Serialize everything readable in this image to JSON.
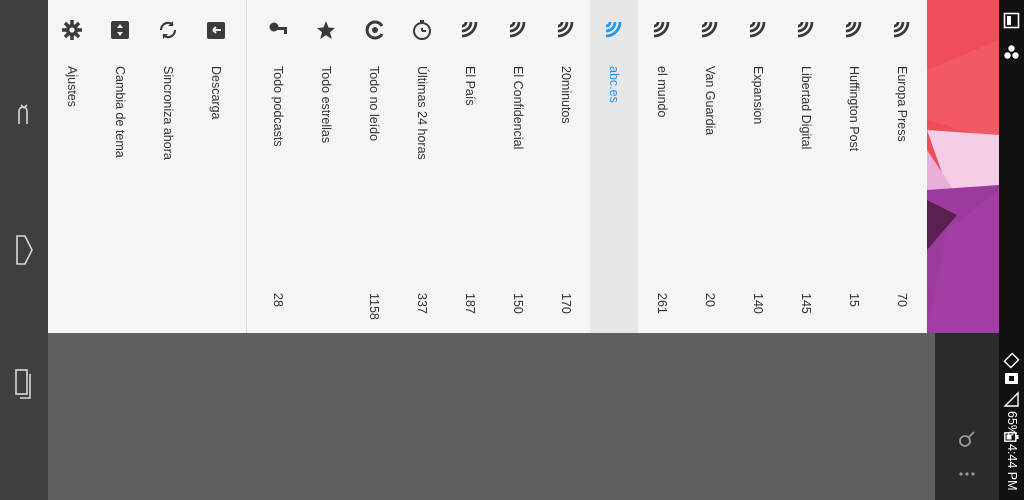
{
  "drawer": {
    "tools": [
      {
        "label": "Ajustes",
        "icon": "gear-icon"
      },
      {
        "label": "Cambia de tema",
        "icon": "theme-swap-icon"
      },
      {
        "label": "Sincroniza ahora",
        "icon": "sync-icon"
      },
      {
        "label": "Descarga",
        "icon": "download-icon"
      }
    ],
    "smart_folders": [
      {
        "label": "Todo podcasts",
        "count": "28",
        "icon": "podcast-icon"
      },
      {
        "label": "Todo estrellas",
        "count": "",
        "icon": "star-icon"
      },
      {
        "label": "Todo no leído",
        "count": "1158",
        "icon": "unread-icon"
      },
      {
        "label": "Últimas 24 horas",
        "count": "337",
        "icon": "clock-icon"
      }
    ],
    "feeds": [
      {
        "label": "El País",
        "count": "187",
        "icon": "rss-icon"
      },
      {
        "label": "El Confidencial",
        "count": "150",
        "icon": "rss-icon"
      },
      {
        "label": "20minutos",
        "count": "170",
        "icon": "rss-icon"
      },
      {
        "label": "abc.es",
        "count": "",
        "icon": "rss-icon",
        "selected": true
      },
      {
        "label": "el mundo",
        "count": "261",
        "icon": "rss-icon"
      },
      {
        "label": "Van Guardia",
        "count": "20",
        "icon": "rss-icon"
      },
      {
        "label": "Expansion",
        "count": "140",
        "icon": "rss-icon"
      },
      {
        "label": "Libertad Digital",
        "count": "145",
        "icon": "rss-icon"
      },
      {
        "label": "Huffington Post",
        "count": "15",
        "icon": "rss-icon"
      },
      {
        "label": "Europa Press",
        "count": "70",
        "icon": "rss-icon"
      }
    ],
    "accent_color": "#2196f3"
  },
  "statusbar": {
    "time": "4:44 PM",
    "battery": "65%"
  },
  "navbar": {
    "buttons": [
      "back-icon",
      "home-icon",
      "recents-icon"
    ]
  },
  "app": {
    "actions": [
      "search-icon",
      "overflow-menu-icon"
    ]
  }
}
